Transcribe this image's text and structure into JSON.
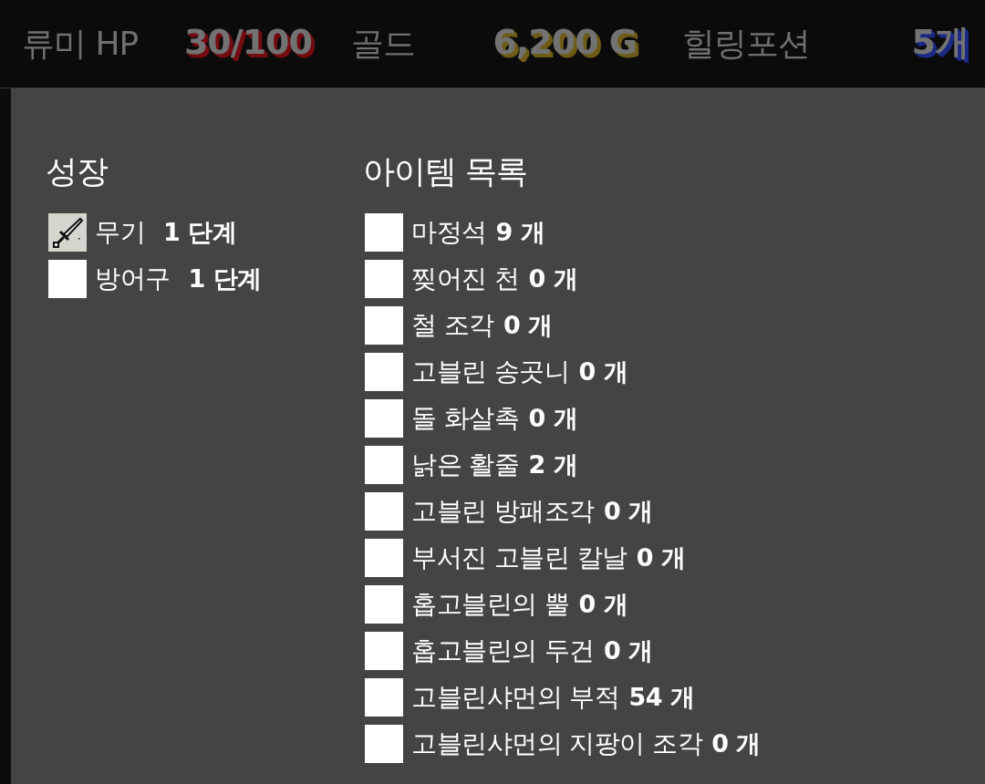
{
  "status_bar": {
    "stats": [
      {
        "kind": "health",
        "label": "류미 HP",
        "value": "30/100"
      },
      {
        "kind": "gold",
        "label": "골드",
        "value": "6,200 G"
      },
      {
        "kind": "potion",
        "label": "힐링포션",
        "value": "5개"
      }
    ]
  },
  "growth": {
    "title": "성장",
    "items": [
      {
        "kind": "sword",
        "name": "무기",
        "level": "1 단계"
      },
      {
        "kind": "blank",
        "name": "방어구",
        "level": "1 단계"
      }
    ]
  },
  "inventory": {
    "title": "아이템 목록",
    "items": [
      {
        "name": "마정석",
        "count": "9 개"
      },
      {
        "name": "찢어진 천",
        "count": "0 개"
      },
      {
        "name": "철 조각",
        "count": "0 개"
      },
      {
        "name": "고블린 송곳니",
        "count": "0 개"
      },
      {
        "name": "돌 화살촉",
        "count": "0 개"
      },
      {
        "name": "낡은 활줄",
        "count": "2 개"
      },
      {
        "name": "고블린 방패조각",
        "count": "0 개"
      },
      {
        "name": "부서진 고블린 칼날",
        "count": "0 개"
      },
      {
        "name": "홉고블린의 뿔",
        "count": "0 개"
      },
      {
        "name": "홉고블린의 두건",
        "count": "0 개"
      },
      {
        "name": "고블린샤먼의 부적",
        "count": "54 개"
      },
      {
        "name": "고블린샤먼의 지팡이 조각",
        "count": "0 개"
      }
    ]
  }
}
